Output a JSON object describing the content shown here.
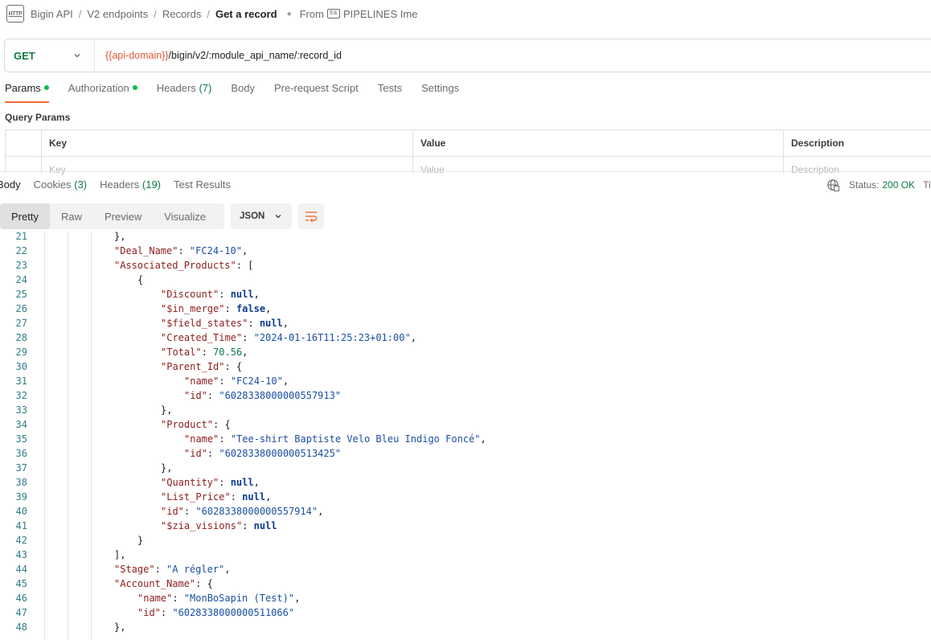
{
  "breadcrumb": {
    "items": [
      "Bigin API",
      "V2 endpoints",
      "Records"
    ],
    "current": "Get a record",
    "from_label": "From",
    "from_icon_glyph": "E&",
    "from_source": "PIPELINES Ime"
  },
  "request": {
    "method": "GET",
    "url_var": "{{api-domain}}",
    "url_rest": "/bigin/v2/:module_api_name/:record_id"
  },
  "request_tabs": [
    {
      "label": "Params",
      "count": "",
      "dot": true,
      "active": true
    },
    {
      "label": "Authorization",
      "count": "",
      "dot": true,
      "active": false
    },
    {
      "label": "Headers",
      "count": "(7)",
      "dot": false,
      "active": false
    },
    {
      "label": "Body",
      "count": "",
      "dot": false,
      "active": false
    },
    {
      "label": "Pre-request Script",
      "count": "",
      "dot": false,
      "active": false
    },
    {
      "label": "Tests",
      "count": "",
      "dot": false,
      "active": false
    },
    {
      "label": "Settings",
      "count": "",
      "dot": false,
      "active": false
    }
  ],
  "query_params": {
    "title": "Query Params",
    "columns": [
      "Key",
      "Value",
      "Description"
    ],
    "placeholders": [
      "Key",
      "Value",
      "Description"
    ]
  },
  "response": {
    "tabs": [
      {
        "label": "Body",
        "count": "",
        "active": true
      },
      {
        "label": "Cookies",
        "count": "(3)",
        "active": false
      },
      {
        "label": "Headers",
        "count": "(19)",
        "active": false
      },
      {
        "label": "Test Results",
        "count": "",
        "active": false
      }
    ],
    "status_label": "Status:",
    "status_value": "200 OK",
    "status_tail": "Ti",
    "view_modes": [
      "Pretty",
      "Raw",
      "Preview",
      "Visualize"
    ],
    "active_view": "Pretty",
    "format": "JSON"
  },
  "colors": {
    "accent": "#f26b3a",
    "method_get": "#0e7a45",
    "url_variable": "#e0583a",
    "key": "#8b1c1c",
    "string": "#1a4fa0",
    "literal": "#0b3c91",
    "number": "#0e7a45"
  },
  "code_lines": [
    {
      "n": 21,
      "indent": 3,
      "tokens": [
        {
          "t": "p",
          "v": "},"
        }
      ]
    },
    {
      "n": 22,
      "indent": 3,
      "tokens": [
        {
          "t": "k",
          "v": "\"Deal_Name\""
        },
        {
          "t": "p",
          "v": ": "
        },
        {
          "t": "s",
          "v": "\"FC24-10\""
        },
        {
          "t": "p",
          "v": ","
        }
      ]
    },
    {
      "n": 23,
      "indent": 3,
      "tokens": [
        {
          "t": "k",
          "v": "\"Associated_Products\""
        },
        {
          "t": "p",
          "v": ": ["
        }
      ]
    },
    {
      "n": 24,
      "indent": 4,
      "tokens": [
        {
          "t": "p",
          "v": "{"
        }
      ]
    },
    {
      "n": 25,
      "indent": 5,
      "tokens": [
        {
          "t": "k",
          "v": "\"Discount\""
        },
        {
          "t": "p",
          "v": ": "
        },
        {
          "t": "kw",
          "v": "null"
        },
        {
          "t": "p",
          "v": ","
        }
      ]
    },
    {
      "n": 26,
      "indent": 5,
      "tokens": [
        {
          "t": "k",
          "v": "\"$in_merge\""
        },
        {
          "t": "p",
          "v": ": "
        },
        {
          "t": "kw",
          "v": "false"
        },
        {
          "t": "p",
          "v": ","
        }
      ]
    },
    {
      "n": 27,
      "indent": 5,
      "tokens": [
        {
          "t": "k",
          "v": "\"$field_states\""
        },
        {
          "t": "p",
          "v": ": "
        },
        {
          "t": "kw",
          "v": "null"
        },
        {
          "t": "p",
          "v": ","
        }
      ]
    },
    {
      "n": 28,
      "indent": 5,
      "tokens": [
        {
          "t": "k",
          "v": "\"Created_Time\""
        },
        {
          "t": "p",
          "v": ": "
        },
        {
          "t": "s",
          "v": "\"2024-01-16T11:25:23+01:00\""
        },
        {
          "t": "p",
          "v": ","
        }
      ]
    },
    {
      "n": 29,
      "indent": 5,
      "tokens": [
        {
          "t": "k",
          "v": "\"Total\""
        },
        {
          "t": "p",
          "v": ": "
        },
        {
          "t": "num",
          "v": "70.56"
        },
        {
          "t": "p",
          "v": ","
        }
      ]
    },
    {
      "n": 30,
      "indent": 5,
      "tokens": [
        {
          "t": "k",
          "v": "\"Parent_Id\""
        },
        {
          "t": "p",
          "v": ": {"
        }
      ]
    },
    {
      "n": 31,
      "indent": 6,
      "tokens": [
        {
          "t": "k",
          "v": "\"name\""
        },
        {
          "t": "p",
          "v": ": "
        },
        {
          "t": "s",
          "v": "\"FC24-10\""
        },
        {
          "t": "p",
          "v": ","
        }
      ]
    },
    {
      "n": 32,
      "indent": 6,
      "tokens": [
        {
          "t": "k",
          "v": "\"id\""
        },
        {
          "t": "p",
          "v": ": "
        },
        {
          "t": "s",
          "v": "\"6028338000000557913\""
        }
      ]
    },
    {
      "n": 33,
      "indent": 5,
      "tokens": [
        {
          "t": "p",
          "v": "},"
        }
      ]
    },
    {
      "n": 34,
      "indent": 5,
      "tokens": [
        {
          "t": "k",
          "v": "\"Product\""
        },
        {
          "t": "p",
          "v": ": {"
        }
      ]
    },
    {
      "n": 35,
      "indent": 6,
      "tokens": [
        {
          "t": "k",
          "v": "\"name\""
        },
        {
          "t": "p",
          "v": ": "
        },
        {
          "t": "s",
          "v": "\"Tee-shirt Baptiste Velo Bleu Indigo Foncé\""
        },
        {
          "t": "p",
          "v": ","
        }
      ]
    },
    {
      "n": 36,
      "indent": 6,
      "tokens": [
        {
          "t": "k",
          "v": "\"id\""
        },
        {
          "t": "p",
          "v": ": "
        },
        {
          "t": "s",
          "v": "\"6028338000000513425\""
        }
      ]
    },
    {
      "n": 37,
      "indent": 5,
      "tokens": [
        {
          "t": "p",
          "v": "},"
        }
      ]
    },
    {
      "n": 38,
      "indent": 5,
      "tokens": [
        {
          "t": "k",
          "v": "\"Quantity\""
        },
        {
          "t": "p",
          "v": ": "
        },
        {
          "t": "kw",
          "v": "null"
        },
        {
          "t": "p",
          "v": ","
        }
      ]
    },
    {
      "n": 39,
      "indent": 5,
      "tokens": [
        {
          "t": "k",
          "v": "\"List_Price\""
        },
        {
          "t": "p",
          "v": ": "
        },
        {
          "t": "kw",
          "v": "null"
        },
        {
          "t": "p",
          "v": ","
        }
      ]
    },
    {
      "n": 40,
      "indent": 5,
      "tokens": [
        {
          "t": "k",
          "v": "\"id\""
        },
        {
          "t": "p",
          "v": ": "
        },
        {
          "t": "s",
          "v": "\"6028338000000557914\""
        },
        {
          "t": "p",
          "v": ","
        }
      ]
    },
    {
      "n": 41,
      "indent": 5,
      "tokens": [
        {
          "t": "k",
          "v": "\"$zia_visions\""
        },
        {
          "t": "p",
          "v": ": "
        },
        {
          "t": "kw",
          "v": "null"
        }
      ]
    },
    {
      "n": 42,
      "indent": 4,
      "tokens": [
        {
          "t": "p",
          "v": "}"
        }
      ]
    },
    {
      "n": 43,
      "indent": 3,
      "tokens": [
        {
          "t": "p",
          "v": "],"
        }
      ]
    },
    {
      "n": 44,
      "indent": 3,
      "tokens": [
        {
          "t": "k",
          "v": "\"Stage\""
        },
        {
          "t": "p",
          "v": ": "
        },
        {
          "t": "s",
          "v": "\"A régler\""
        },
        {
          "t": "p",
          "v": ","
        }
      ]
    },
    {
      "n": 45,
      "indent": 3,
      "tokens": [
        {
          "t": "k",
          "v": "\"Account_Name\""
        },
        {
          "t": "p",
          "v": ": {"
        }
      ]
    },
    {
      "n": 46,
      "indent": 4,
      "tokens": [
        {
          "t": "k",
          "v": "\"name\""
        },
        {
          "t": "p",
          "v": ": "
        },
        {
          "t": "s",
          "v": "\"MonBoSapin (Test)\""
        },
        {
          "t": "p",
          "v": ","
        }
      ]
    },
    {
      "n": 47,
      "indent": 4,
      "tokens": [
        {
          "t": "k",
          "v": "\"id\""
        },
        {
          "t": "p",
          "v": ": "
        },
        {
          "t": "s",
          "v": "\"6028338000000511066\""
        }
      ]
    },
    {
      "n": 48,
      "indent": 3,
      "tokens": [
        {
          "t": "p",
          "v": "},"
        }
      ]
    }
  ]
}
